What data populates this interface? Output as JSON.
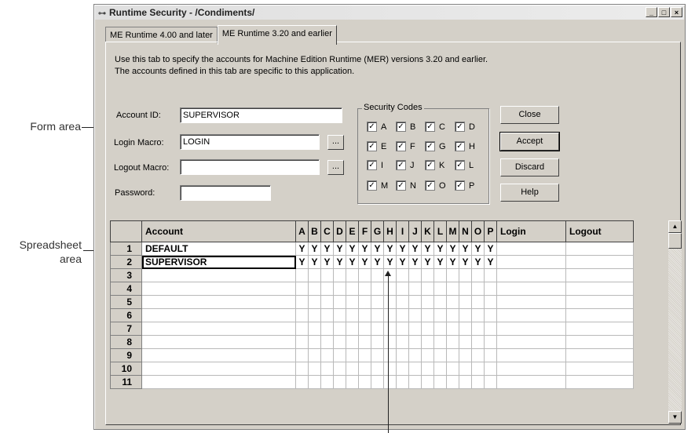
{
  "callouts": {
    "form_area": "Form area",
    "spreadsheet_area_line1": "Spreadsheet",
    "spreadsheet_area_line2": "area"
  },
  "window": {
    "title": "Runtime Security - /Condiments/",
    "min": "_",
    "max": "□",
    "close": "×"
  },
  "tabs": [
    {
      "label": "ME Runtime 4.00 and later"
    },
    {
      "label": "ME Runtime 3.20 and earlier"
    }
  ],
  "description": {
    "line1": "Use this tab to specify the accounts for Machine Edition Runtime (MER) versions 3.20 and earlier.",
    "line2": "The accounts defined in this tab are specific to this application."
  },
  "form": {
    "account_id_label": "Account ID:",
    "account_id_value": "SUPERVISOR",
    "login_macro_label": "Login Macro:",
    "login_macro_value": "LOGIN",
    "logout_macro_label": "Logout Macro:",
    "logout_macro_value": "",
    "password_label": "Password:",
    "password_value": "",
    "browse": "..."
  },
  "security_codes": {
    "title": "Security Codes",
    "codes": [
      {
        "label": "A",
        "checked": true
      },
      {
        "label": "B",
        "checked": true
      },
      {
        "label": "C",
        "checked": true
      },
      {
        "label": "D",
        "checked": true
      },
      {
        "label": "E",
        "checked": true
      },
      {
        "label": "F",
        "checked": true
      },
      {
        "label": "G",
        "checked": true
      },
      {
        "label": "H",
        "checked": true
      },
      {
        "label": "I",
        "checked": true
      },
      {
        "label": "J",
        "checked": true
      },
      {
        "label": "K",
        "checked": true
      },
      {
        "label": "L",
        "checked": true
      },
      {
        "label": "M",
        "checked": true
      },
      {
        "label": "N",
        "checked": true
      },
      {
        "label": "O",
        "checked": true
      },
      {
        "label": "P",
        "checked": true
      }
    ]
  },
  "buttons": {
    "close": "Close",
    "accept": "Accept",
    "discard": "Discard",
    "help": "Help"
  },
  "grid": {
    "headers": {
      "account": "Account",
      "login": "Login",
      "logout": "Logout"
    },
    "code_headers": [
      "A",
      "B",
      "C",
      "D",
      "E",
      "F",
      "G",
      "H",
      "I",
      "J",
      "K",
      "L",
      "M",
      "N",
      "O",
      "P"
    ],
    "rows": [
      {
        "num": "1",
        "account": "DEFAULT",
        "codes": [
          "Y",
          "Y",
          "Y",
          "Y",
          "Y",
          "Y",
          "Y",
          "Y",
          "Y",
          "Y",
          "Y",
          "Y",
          "Y",
          "Y",
          "Y",
          "Y"
        ],
        "login": "",
        "logout": ""
      },
      {
        "num": "2",
        "account": "SUPERVISOR",
        "codes": [
          "Y",
          "Y",
          "Y",
          "Y",
          "Y",
          "Y",
          "Y",
          "Y",
          "Y",
          "Y",
          "Y",
          "Y",
          "Y",
          "Y",
          "Y",
          "Y"
        ],
        "login": "",
        "logout": ""
      },
      {
        "num": "3",
        "account": "",
        "codes": [],
        "login": "",
        "logout": ""
      },
      {
        "num": "4",
        "account": "",
        "codes": [],
        "login": "",
        "logout": ""
      },
      {
        "num": "5",
        "account": "",
        "codes": [],
        "login": "",
        "logout": ""
      },
      {
        "num": "6",
        "account": "",
        "codes": [],
        "login": "",
        "logout": ""
      },
      {
        "num": "7",
        "account": "",
        "codes": [],
        "login": "",
        "logout": ""
      },
      {
        "num": "8",
        "account": "",
        "codes": [],
        "login": "",
        "logout": ""
      },
      {
        "num": "9",
        "account": "",
        "codes": [],
        "login": "",
        "logout": ""
      },
      {
        "num": "10",
        "account": "",
        "codes": [],
        "login": "",
        "logout": ""
      },
      {
        "num": "11",
        "account": "",
        "codes": [],
        "login": "",
        "logout": ""
      }
    ]
  },
  "scrollbar": {
    "up": "▲",
    "down": "▼"
  }
}
